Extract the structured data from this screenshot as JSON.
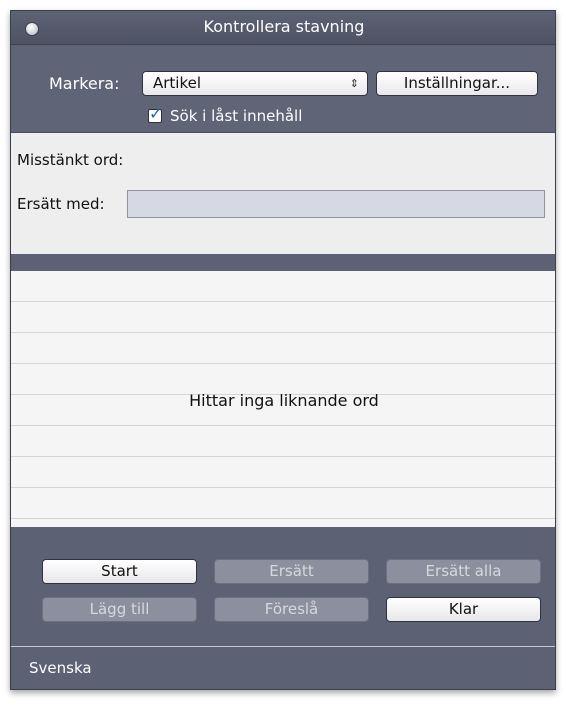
{
  "window": {
    "title": "Kontrollera stavning"
  },
  "top": {
    "markera_label": "Markera:",
    "select_value": "Artikel",
    "settings_label": "Inställningar...",
    "checkbox_label": "Sök i låst innehåll",
    "checkbox_checked": true
  },
  "word": {
    "suspect_label": "Misstänkt ord:",
    "replace_label": "Ersätt med:",
    "replace_value": ""
  },
  "suggestions": {
    "empty_message": "Hittar inga liknande ord"
  },
  "buttons": {
    "start": "Start",
    "replace": "Ersätt",
    "replace_all": "Ersätt alla",
    "add": "Lägg till",
    "suggest": "Föreslå",
    "done": "Klar"
  },
  "footer": {
    "language": "Svenska"
  }
}
